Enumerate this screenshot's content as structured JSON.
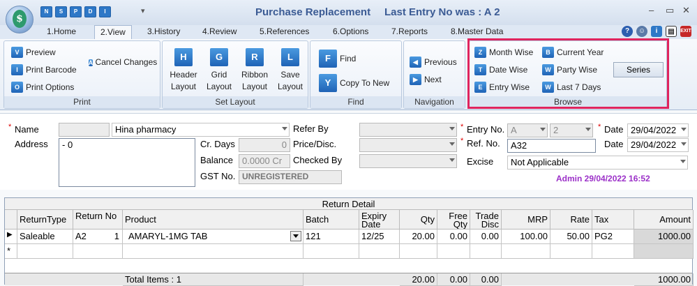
{
  "window": {
    "title": "Purchase Replacement",
    "last_entry": "Last Entry No was : A 2",
    "minimize": "–",
    "maximize": "▭",
    "close": "✕"
  },
  "quick_access": [
    "N",
    "S",
    "P",
    "D",
    "I"
  ],
  "tabs": [
    {
      "label": "1.Home"
    },
    {
      "label": "2.View"
    },
    {
      "label": "3.History"
    },
    {
      "label": "4.Review"
    },
    {
      "label": "5.References"
    },
    {
      "label": "6.Options"
    },
    {
      "label": "7.Reports"
    },
    {
      "label": "8.Master Data"
    }
  ],
  "ribbon": {
    "print": {
      "label": "Print",
      "preview": "Preview",
      "print_barcode": "Print Barcode",
      "print_options": "Print Options",
      "cancel_changes": "Cancel Changes"
    },
    "set_layout": {
      "label": "Set Layout",
      "header": [
        "Header",
        "Layout"
      ],
      "grid": [
        "Grid",
        "Layout"
      ],
      "ribbon": [
        "Ribbon",
        "Layout"
      ],
      "save": [
        "Save",
        "Layout"
      ]
    },
    "find": {
      "label": "Find",
      "find": "Find",
      "copy_to_new": "Copy To New"
    },
    "navigation": {
      "label": "Navigation",
      "previous": "Previous",
      "next": "Next"
    },
    "browse": {
      "label": "Browse",
      "month_wise": "Month Wise",
      "date_wise": "Date Wise",
      "entry_wise": "Entry Wise",
      "current_year": "Current Year",
      "party_wise": "Party Wise",
      "last_7_days": "Last 7 Days",
      "series": "Series"
    }
  },
  "form": {
    "name_label": "Name",
    "name_value": "Hina pharmacy",
    "address_label": "Address",
    "address_value": "- 0",
    "cr_days_label": "Cr. Days",
    "cr_days_value": "0",
    "balance_label": "Balance",
    "balance_value": "0.0000 Cr",
    "gst_label": "GST No.",
    "gst_value": "UNREGISTERED",
    "refer_by_label": "Refer By",
    "price_disc_label": "Price/Disc.",
    "checked_by_label": "Checked By",
    "entry_no_label": "Entry No.",
    "entry_series": "A",
    "entry_number": "2",
    "ref_no_label": "Ref. No.",
    "ref_no_value": "A32",
    "excise_label": "Excise",
    "excise_value": "Not Applicable",
    "date_label": "Date",
    "date_value": "29/04/2022",
    "date2_label": "Date",
    "date2_value": "29/04/2022",
    "admin_stamp": "Admin 29/04/2022 16:52"
  },
  "grid": {
    "title": "Return Detail",
    "columns": [
      "ReturnType",
      "Return No",
      "Product",
      "Batch",
      "Expiry Date",
      "Qty",
      "Free Qty",
      "Trade Disc",
      "MRP",
      "Rate",
      "Tax",
      "Amount"
    ],
    "rows": [
      {
        "return_type": "Saleable",
        "return_no": "A2",
        "return_sub": "1",
        "product": "AMARYL-1MG TAB",
        "batch": "121",
        "expiry": "12/25",
        "qty": "20.00",
        "free_qty": "0.00",
        "trade_disc": "0.00",
        "mrp": "100.00",
        "rate": "50.00",
        "tax": "PG2",
        "amount": "1000.00"
      }
    ],
    "totals": {
      "label": "Total Items : 1",
      "qty": "20.00",
      "free_qty": "0.00",
      "trade_disc": "0.00",
      "amount": "1000.00"
    }
  },
  "colors": {
    "highlight": "#e0245e",
    "title": "#3b5b94",
    "admin": "#9b30c8"
  }
}
